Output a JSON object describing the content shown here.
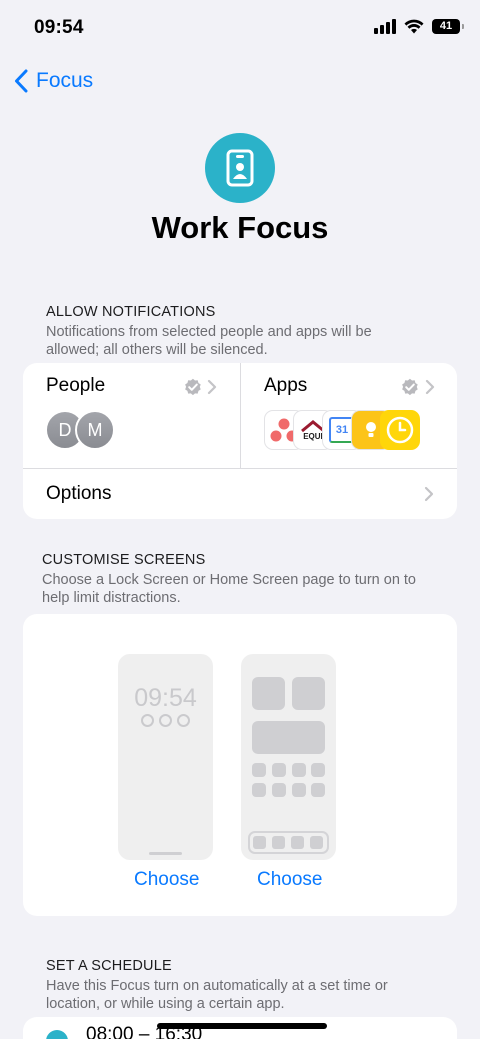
{
  "status_bar": {
    "time": "09:54",
    "battery": "41"
  },
  "nav": {
    "back_label": "Focus"
  },
  "hero": {
    "title": "Work Focus",
    "icon": "person-badge-icon",
    "accent": "#2bb2c9"
  },
  "allow_notifications": {
    "header": "ALLOW NOTIFICATIONS",
    "description": "Notifications from selected people and apps will be allowed; all others will be silenced.",
    "people": {
      "label": "People",
      "avatars": [
        "D",
        "M"
      ]
    },
    "apps": {
      "label": "Apps",
      "icons": [
        "asana-icon",
        "equifax-icon",
        "google-calendar-icon",
        "notes-icon",
        "clock-icon"
      ],
      "equifax_text": "EQUI",
      "calendar_day": "31"
    },
    "options": {
      "label": "Options"
    }
  },
  "customise_screens": {
    "header": "CUSTOMISE SCREENS",
    "description": "Choose a Lock Screen or Home Screen page to turn on to help limit distractions.",
    "lock_preview_time": "09:54",
    "lock_choose_label": "Choose",
    "home_choose_label": "Choose"
  },
  "schedule": {
    "header": "SET A SCHEDULE",
    "description": "Have this Focus turn on automatically at a set time or location, or while using a certain app.",
    "item_time": "08:00 – 16:30"
  },
  "colors": {
    "accent_blue": "#0a7aff",
    "background": "#f2f2f7"
  }
}
